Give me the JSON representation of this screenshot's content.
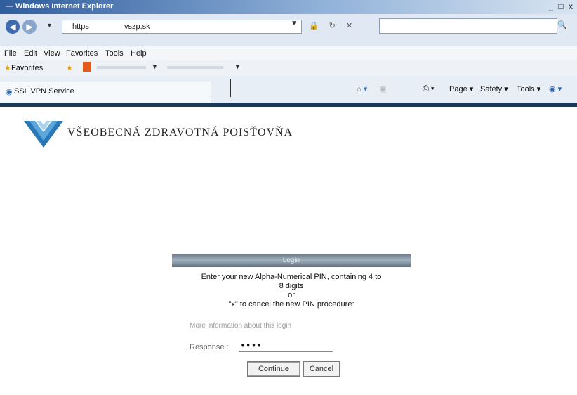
{
  "window": {
    "title": "— Windows Internet Explorer",
    "controls": "_ □ x"
  },
  "address": {
    "protocol": "https",
    "domain": "vszp.sk",
    "search_value": ""
  },
  "menubar": {
    "items": [
      "File",
      "Edit",
      "View",
      "Favorites",
      "Tools",
      "Help"
    ]
  },
  "favorites": {
    "label": "Favorites"
  },
  "tab": {
    "label": "SSL VPN Service"
  },
  "commandbar": {
    "page": "Page ▾",
    "safety": "Safety ▾",
    "tools": "Tools ▾"
  },
  "logo": {
    "text": "VŠEOBECNÁ ZDRAVOTNÁ POISŤOVŇA"
  },
  "login": {
    "header": "Login",
    "line1": "Enter your new Alpha-Numerical PIN, containing 4 to",
    "line2": "8 digits",
    "line3": "or",
    "line4": "\"x\" to cancel the new PIN procedure:",
    "more_info": "More information about this login",
    "response_label": "Response :",
    "response_value": "••••",
    "continue_label": "Continue",
    "cancel_label": "Cancel"
  }
}
